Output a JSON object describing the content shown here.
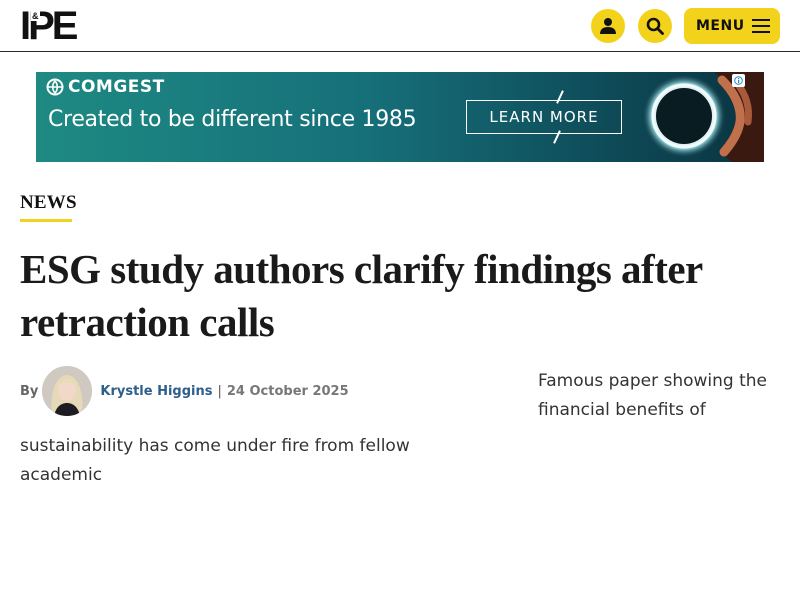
{
  "header": {
    "logo_text": "IPE",
    "logo_amp": "&",
    "menu_label": "MENU",
    "icons": [
      "account-icon",
      "search-icon",
      "hamburger-icon"
    ],
    "accent_color": "#f3d21b"
  },
  "ad": {
    "brand": "COMGEST",
    "headline": "Created to be different since 1985",
    "cta": "LEARN MORE",
    "info_icon": "adchoices-icon"
  },
  "article": {
    "section": "NEWS",
    "headline": "ESG study authors clarify findings after retraction calls",
    "byline_prefix": "By",
    "author": "Krystle Higgins",
    "separator": "|",
    "date": "24 October 2025",
    "standfirst_part1": "Famous paper showing the financial benefits of",
    "standfirst_part2": "sustainability has come under fire from fellow academic"
  }
}
